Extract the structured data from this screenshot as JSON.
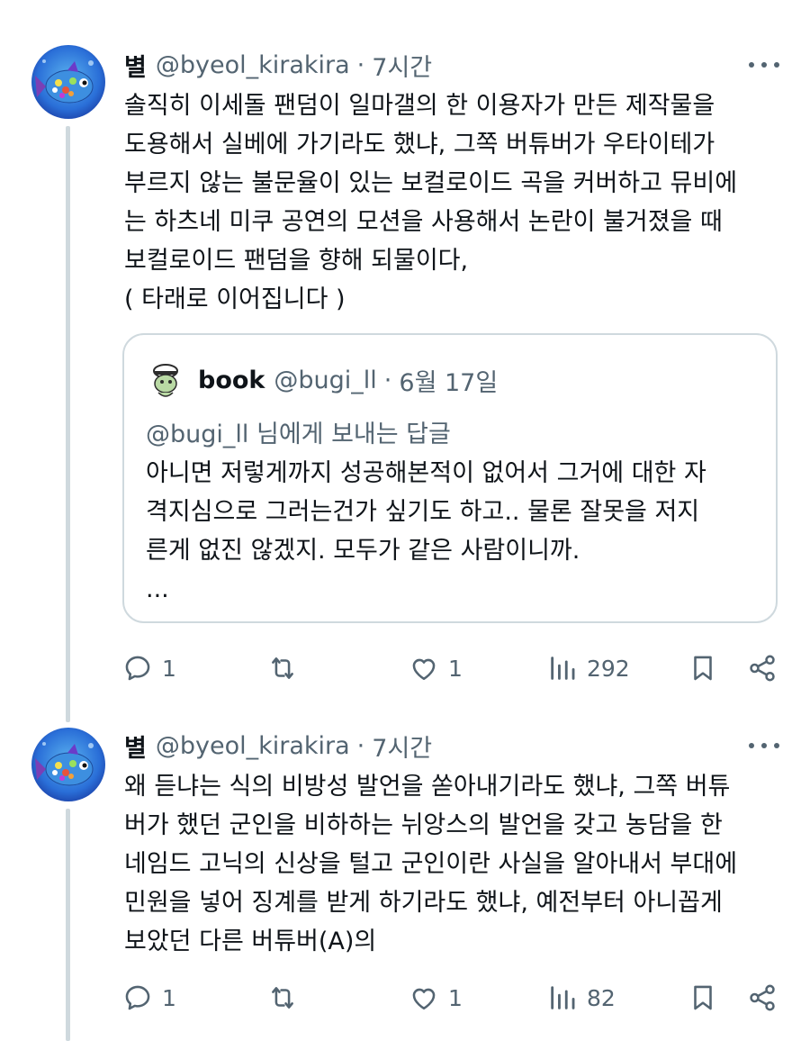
{
  "tweets": [
    {
      "display_name": "별",
      "handle": "@byeol_kirakira",
      "separator": "·",
      "time": "7시간",
      "text_lines": [
        "솔직히 이세돌 팬덤이 일마갤의 한 이용자가 만든 제작물을",
        "도용해서 실베에 가기라도 했냐, 그쪽 버튜버가 우타이테가",
        "부르지 않는 불문율이 있는 보컬로이드 곡을 커버하고 뮤비에",
        "는 하츠네 미쿠 공연의 모션을 사용해서 논란이 불거졌을 때",
        "보컬로이드 팬덤을 향해 되물이다,",
        "( 타래로 이어집니다 )"
      ],
      "quote": {
        "display_name": "book",
        "handle": "@bugi_ll",
        "separator": "·",
        "date": "6월 17일",
        "replying_to": "@bugi_ll 님에게 보내는 답글",
        "text_lines": [
          "아니면 저렇게까지 성공해본적이 없어서 그거에 대한 자",
          "격지심으로 그러는건가 싶기도 하고.. 물론 잘못을 저지",
          "른게 없진 않겠지. 모두가 같은 사람이니까.",
          "..."
        ]
      },
      "actions": {
        "replies": "1",
        "retweets": "",
        "likes": "1",
        "views": "292"
      }
    },
    {
      "display_name": "별",
      "handle": "@byeol_kirakira",
      "separator": "·",
      "time": "7시간",
      "text_lines": [
        "왜 듣냐는 식의 비방성 발언을 쏟아내기라도 했냐, 그쪽 버튜",
        "버가 했던 군인을 비하하는 뉘앙스의 발언을 갖고 농담을 한",
        "네임드 고닉의 신상을 털고 군인이란 사실을 알아내서 부대에",
        "민원을 넣어 징계를 받게 하기라도 했냐, 예전부터 아니꼽게",
        "보았던 다른 버튜버(A)의"
      ],
      "actions": {
        "replies": "1",
        "retweets": "",
        "likes": "1",
        "views": "82"
      }
    }
  ],
  "colors": {
    "text": "#0f1419",
    "secondary": "#536471",
    "border": "#cfd9de",
    "thread_line": "#cfd9de"
  },
  "icons": [
    "reply-icon",
    "retweet-icon",
    "like-icon",
    "views-icon",
    "bookmark-icon",
    "share-icon",
    "more-icon"
  ]
}
